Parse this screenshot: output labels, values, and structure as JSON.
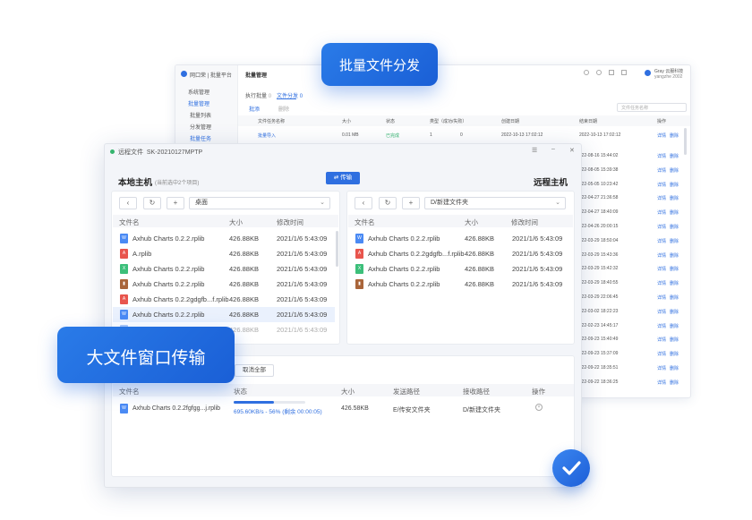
{
  "back": {
    "logo": "网口荣 | 批量平台",
    "top_title": "批量管理",
    "user": "Gray 云服科技",
    "user_sub": "yangzhe 2002",
    "sidebar": [
      "系统管理",
      "批量管理",
      "批量列表",
      "分发管理",
      "批量任务"
    ],
    "tabs": [
      "执行批量",
      "文件分发"
    ],
    "tab_counts": [
      "0",
      "0"
    ],
    "actions": [
      "批添",
      "删除"
    ],
    "search_placeholder": "文件任务名称",
    "headers": [
      "文件任务名称",
      "大小",
      "状态",
      "类型（成功/失败）",
      "",
      "创建日期",
      "结束日期",
      "操作"
    ],
    "first_row": {
      "name": "批量导入",
      "size": "0.01 MB",
      "status": "已完成",
      "a": "1",
      "b": "0",
      "created": "2022-10-13 17:02:12",
      "ended": "2022-10-13 17:02:12"
    },
    "dates": [
      "2022-08-16 15:44:02",
      "2022-08-05 15:39:38",
      "2022-05-05 10:23:42",
      "2022-04-27 21:36:58",
      "2022-04-27 18:40:09",
      "2022-04-26 20:00:15",
      "2022-03-29 18:50:04",
      "2022-03-29 15:43:36",
      "2022-03-29 15:42:32",
      "2022-03-29 18:40:55",
      "2022-03-29 22:06:45",
      "2022-03-02 18:22:23",
      "2022-02-23 14:45:17",
      "2022-09-23 15:40:49",
      "2022-09-23 15:37:09",
      "2022-09-22 18:35:51",
      "2022-09-22 18:36:25"
    ],
    "op1": "详情",
    "op2": "删除"
  },
  "window": {
    "title": "远程文件",
    "session": "SK-20210127MPTP",
    "local_title": "本地主机",
    "local_sub": "(当前选中2个项目)",
    "remote_title": "远程主机",
    "transfer_button": "传输",
    "local_path": "桌面",
    "remote_path": "D/新建文件夹",
    "col_name": "文件名",
    "col_size": "大小",
    "col_time": "修改时间",
    "local_files": [
      {
        "icon": "blue",
        "name": "Axhub Charts 0.2.2.rplib",
        "size": "426.88KB",
        "time": "2021/1/6 5:43:09"
      },
      {
        "icon": "red",
        "name": "A.rplib",
        "size": "426.88KB",
        "time": "2021/1/6 5:43:09"
      },
      {
        "icon": "green",
        "name": "Axhub Charts 0.2.2.rplib",
        "size": "426.88KB",
        "time": "2021/1/6 5:43:09"
      },
      {
        "icon": "brown",
        "name": "Axhub Charts 0.2.2.rplib",
        "size": "426.88KB",
        "time": "2021/1/6 5:43:09"
      },
      {
        "icon": "red",
        "name": "Axhub Charts 0.2.2gdgfb...f.rplib",
        "size": "426.88KB",
        "time": "2021/1/6 5:43:09"
      },
      {
        "icon": "blue",
        "name": "Axhub Charts 0.2.2.rplib",
        "size": "426.88KB",
        "time": "2021/1/6 5:43:09"
      },
      {
        "icon": "blue",
        "name": "Axhub Charts 0.2.2.rplib",
        "size": "426.88KB",
        "time": "2021/1/6 5:43:09"
      }
    ],
    "remote_files": [
      {
        "icon": "blue",
        "name": "Axhub Charts 0.2.2.rplib",
        "size": "426.88KB",
        "time": "2021/1/6 5:43:09"
      },
      {
        "icon": "red",
        "name": "Axhub Charts 0.2.2gdgfb...f.rplib",
        "size": "426.88KB",
        "time": "2021/1/6 5:43:09"
      },
      {
        "icon": "green",
        "name": "Axhub Charts 0.2.2.rplib",
        "size": "426.88KB",
        "time": "2021/1/6 5:43:09"
      },
      {
        "icon": "brown",
        "name": "Axhub Charts 0.2.2.rplib",
        "size": "426.88KB",
        "time": "2021/1/6 5:43:09"
      }
    ],
    "cancel_all": "取消全部",
    "queue_headers": [
      "文件名",
      "状态",
      "大小",
      "发送路径",
      "接收路径",
      "操作"
    ],
    "queue_row": {
      "name": "Axhub Charts 0.2.2fgfgg...j.rplib",
      "status": "695.60KB/s - 56% (剩余 00:00:05)",
      "progress": 0.56,
      "size": "426.58KB",
      "send": "E/传安文件夹",
      "recv": "D/新建文件夹"
    }
  },
  "badges": {
    "batch": "批量文件分发",
    "large": "大文件窗口传输"
  },
  "colors": {
    "accent": "#2f6fe0",
    "success": "#35b46e"
  }
}
